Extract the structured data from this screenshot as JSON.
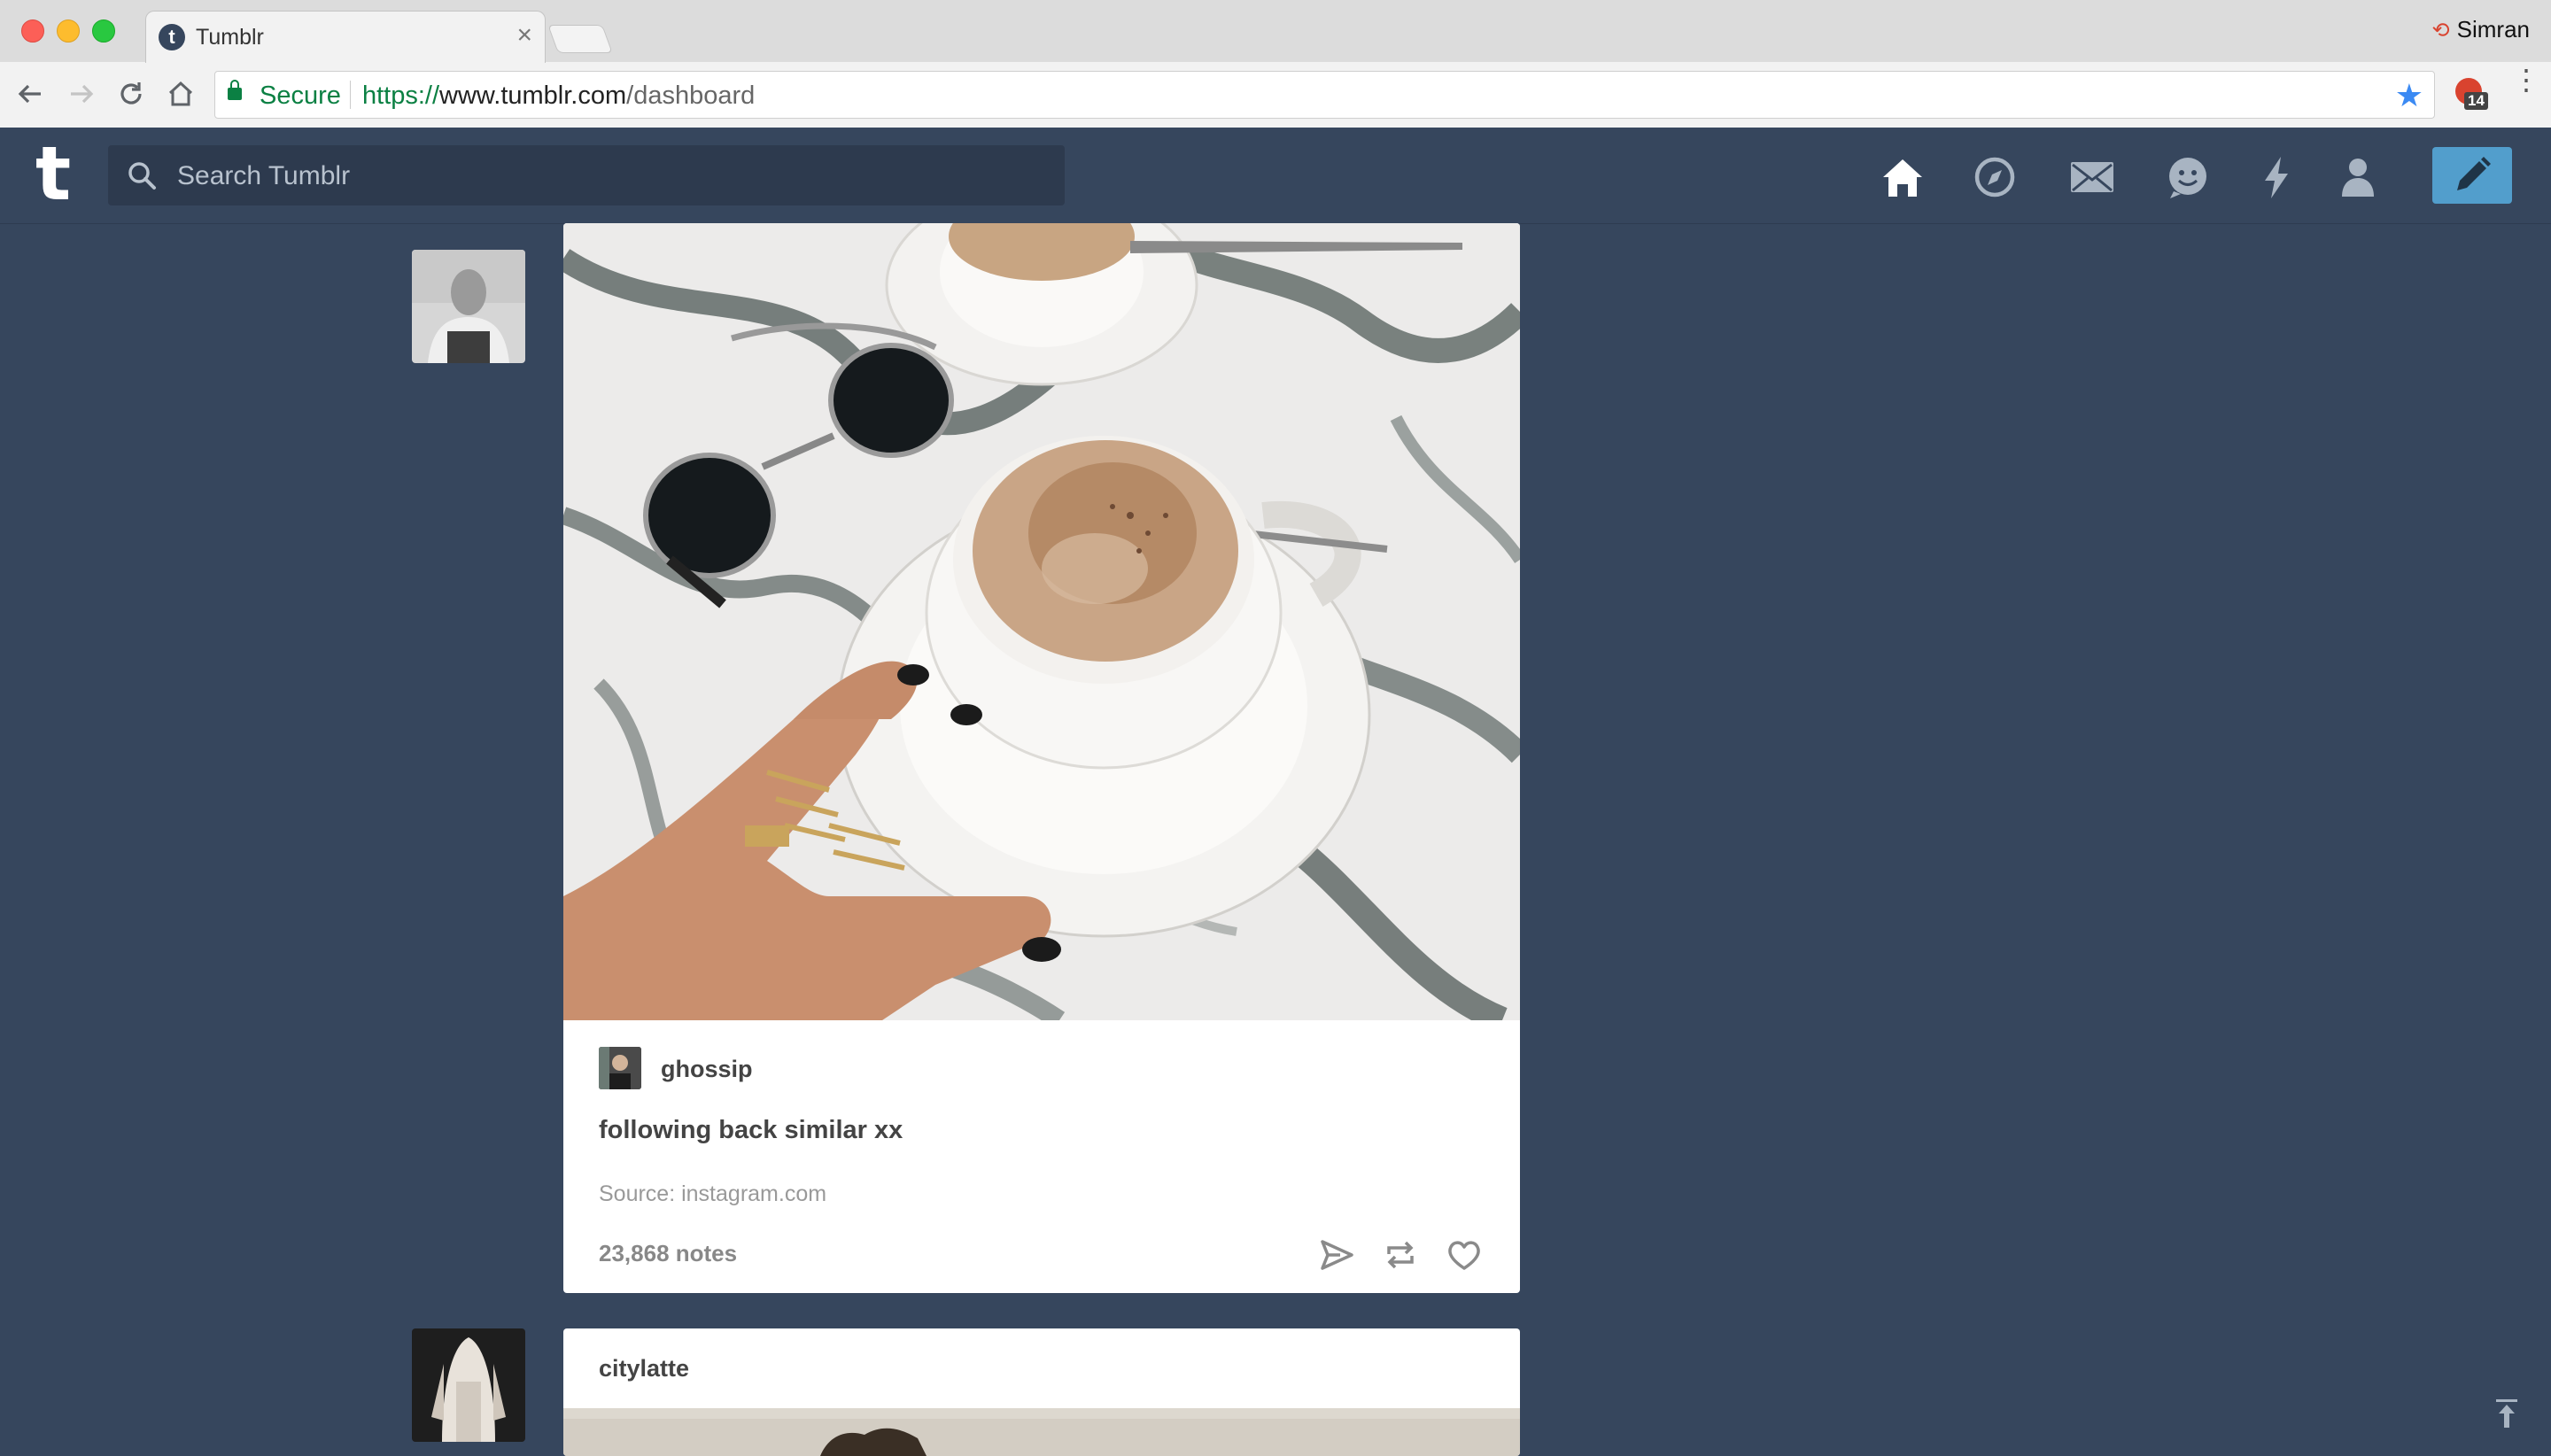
{
  "browser": {
    "tab_title": "Tumblr",
    "tab_favicon": "t",
    "tab_close": "×",
    "profile_name": "Simran",
    "address": {
      "secure_label": "Secure",
      "url_scheme": "https://",
      "url_host": "www.tumblr.com",
      "url_path": "/dashboard"
    },
    "extension_badge": "14"
  },
  "header": {
    "logo": "t",
    "search_placeholder": "Search Tumblr",
    "nav_icons": [
      "home-icon",
      "explore-icon",
      "inbox-icon",
      "messaging-icon",
      "activity-icon",
      "account-icon"
    ],
    "compose_icon": "pencil-icon",
    "accent_color": "#529ecc"
  },
  "posts": [
    {
      "blog_name": "ghossip",
      "caption": "following back similar xx",
      "source": "Source: instagram.com",
      "notes": "23,868 notes",
      "actions": [
        "share-icon",
        "reblog-icon",
        "like-icon"
      ]
    },
    {
      "blog_name": "citylatte"
    }
  ],
  "colors": {
    "background": "#36465d",
    "secure_green": "#0b8043"
  }
}
